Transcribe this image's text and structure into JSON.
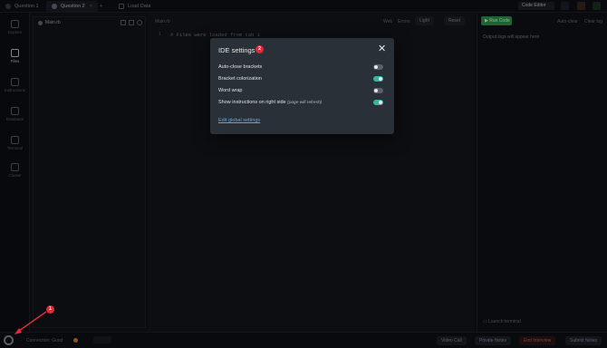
{
  "tabs": [
    {
      "label": "Question 1"
    },
    {
      "label": "Question 2"
    },
    {
      "label": "+"
    },
    {
      "label": "Load Data"
    }
  ],
  "topright": {
    "code_editor": "Code Editor"
  },
  "sidebar": {
    "items": [
      {
        "label": "Explore"
      },
      {
        "label": "Files"
      },
      {
        "label": "Instructions"
      },
      {
        "label": "Database"
      },
      {
        "label": "Terminal"
      },
      {
        "label": "Cluster"
      }
    ]
  },
  "filepanel": {
    "title": "Main.rb"
  },
  "editor": {
    "filename": "Main.rb",
    "line_number": "1",
    "code_line": "# Files were loaded from tab 1",
    "toolbar": [
      "Web",
      "Errors",
      "Light",
      "Reset"
    ]
  },
  "rightpanel": {
    "run_label": "Run Code",
    "links": [
      "Auto-clear",
      "Clear log"
    ],
    "placeholder": "Output logs will appear here",
    "launch_terminal": "Launch terminal"
  },
  "bottombar": {
    "left_text": "Connection: Good",
    "buttons": [
      "Video Call",
      "Private Notes",
      "End Interview",
      "Submit Notes"
    ]
  },
  "modal": {
    "title": "IDE settings",
    "badge": "2",
    "close_symbol": "✕",
    "settings": [
      {
        "label": "Auto-close brackets",
        "hint": "",
        "enabled": false
      },
      {
        "label": "Bracket colorization",
        "hint": "",
        "enabled": true
      },
      {
        "label": "Word wrap",
        "hint": "",
        "enabled": false
      },
      {
        "label": "Show instructions on right side",
        "hint": "(page will refresh)",
        "enabled": true
      }
    ],
    "global_link": "Edit global settings"
  },
  "annotation": {
    "badge": "1"
  },
  "colors": {
    "accent_green": "#34b5a0",
    "badge_red": "#e02b3a",
    "link_blue": "#5ea5e8",
    "modal_bg": "#2a3038"
  }
}
